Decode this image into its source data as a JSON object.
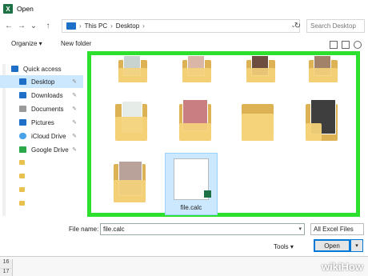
{
  "window": {
    "title": "Open"
  },
  "nav": {
    "back": "←",
    "forward": "→",
    "dropdown": "⌄",
    "up": "↑",
    "breadcrumb": [
      "This PC",
      "Desktop"
    ],
    "search_placeholder": "Search Desktop"
  },
  "toolbar": {
    "organize": "Organize ▾",
    "new_folder": "New folder"
  },
  "sidebar": {
    "items": [
      {
        "label": "Quick access",
        "color": "#1e6fc8"
      },
      {
        "label": "Desktop",
        "color": "#1e6fc8"
      },
      {
        "label": "Downloads",
        "color": "#1e6fc8"
      },
      {
        "label": "Documents",
        "color": "#777777"
      },
      {
        "label": "Pictures",
        "color": "#1e6fc8"
      },
      {
        "label": "iCloud Drive",
        "color": "#4aa3e8"
      },
      {
        "label": "Google Drive",
        "color": "#2aa84a"
      }
    ]
  },
  "files": {
    "selected_label": "file.calc"
  },
  "bottom": {
    "filename_label": "File name:",
    "filename_value": "file.calc",
    "filetype": "All Excel Files",
    "tools": "Tools",
    "open": "Open"
  },
  "rows": [
    "16",
    "17"
  ],
  "watermark": "wikiHow",
  "colors": {
    "highlight": "#2ee02e",
    "selected": "#cce8ff",
    "accent": "#0078d7"
  }
}
